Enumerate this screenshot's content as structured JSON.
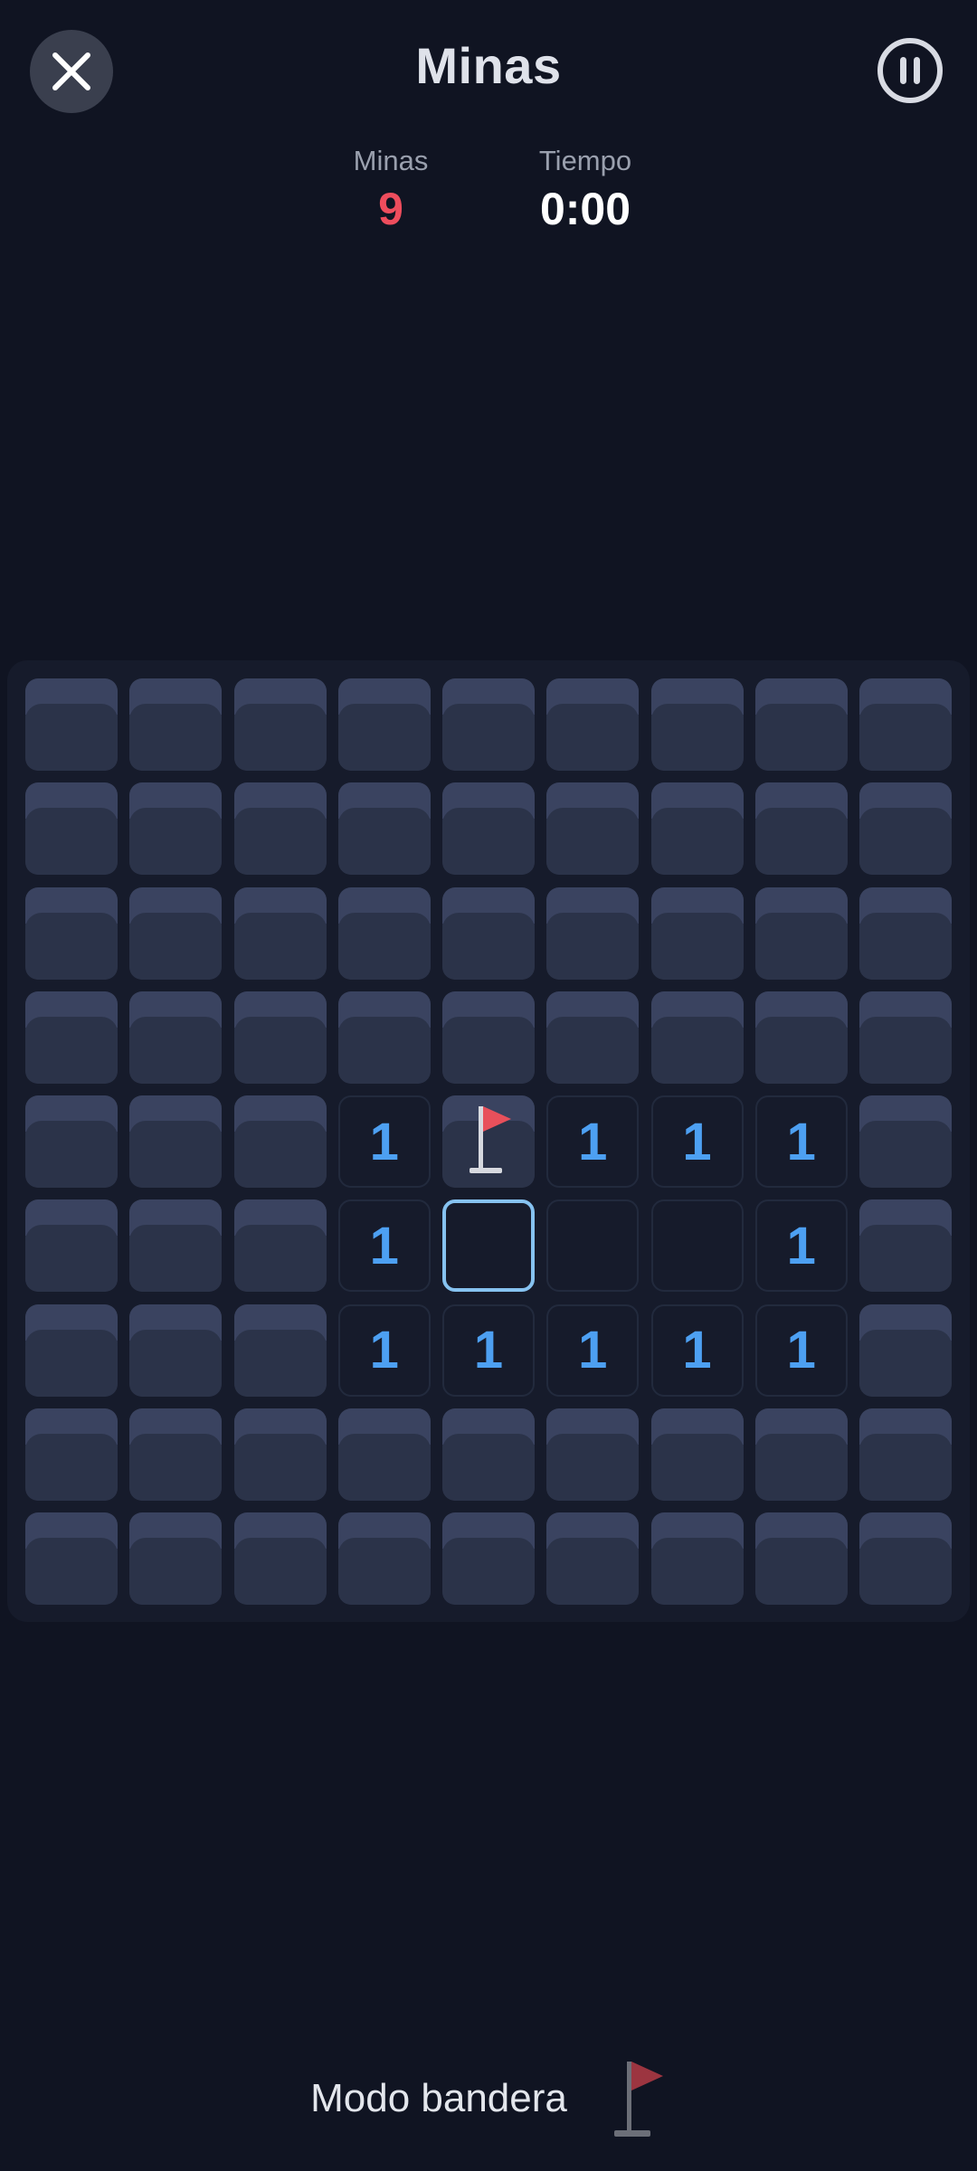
{
  "header": {
    "title": "Minas",
    "close_icon": "close-icon",
    "pause_icon": "pause-icon"
  },
  "stats": {
    "mines_label": "Minas",
    "mines_value": "9",
    "time_label": "Tiempo",
    "time_value": "0:00"
  },
  "board": {
    "rows": 9,
    "cols": 9,
    "cells": [
      [
        "h",
        "h",
        "h",
        "h",
        "h",
        "h",
        "h",
        "h",
        "h"
      ],
      [
        "h",
        "h",
        "h",
        "h",
        "h",
        "h",
        "h",
        "h",
        "h"
      ],
      [
        "h",
        "h",
        "h",
        "h",
        "h",
        "h",
        "h",
        "h",
        "h"
      ],
      [
        "h",
        "h",
        "h",
        "h",
        "h",
        "h",
        "h",
        "h",
        "h"
      ],
      [
        "h",
        "h",
        "h",
        "1",
        "f",
        "1",
        "1",
        "1",
        "h"
      ],
      [
        "h",
        "h",
        "h",
        "1",
        "s",
        "0",
        "0",
        "1",
        "h"
      ],
      [
        "h",
        "h",
        "h",
        "1",
        "1",
        "1",
        "1",
        "1",
        "h"
      ],
      [
        "h",
        "h",
        "h",
        "h",
        "h",
        "h",
        "h",
        "h",
        "h"
      ],
      [
        "h",
        "h",
        "h",
        "h",
        "h",
        "h",
        "h",
        "h",
        "h"
      ]
    ]
  },
  "footer": {
    "flag_mode_label": "Modo bandera",
    "flag_icon": "flag-icon"
  },
  "colors": {
    "background": "#101422",
    "mines_count": "#ee4d5d",
    "number": "#4da0f2",
    "flag": "#e8505b",
    "selected_border": "#86c2f0"
  }
}
